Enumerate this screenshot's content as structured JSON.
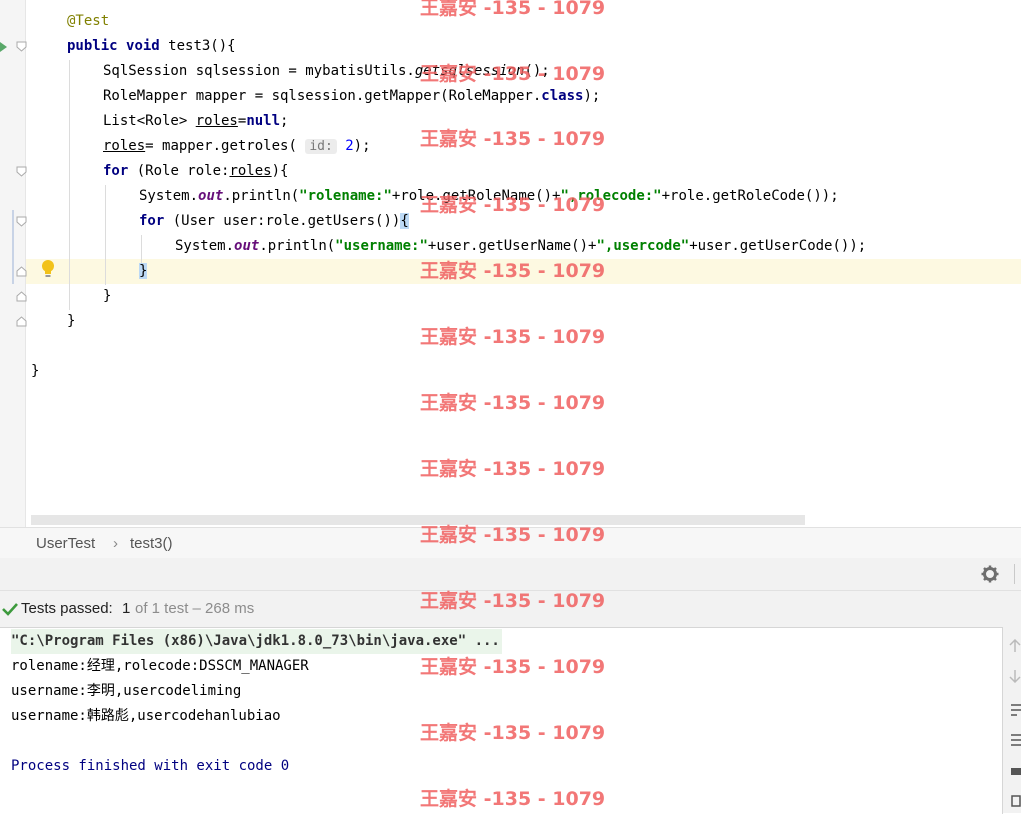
{
  "editor": {
    "lines": {
      "l1": "@Test",
      "l2_kw1": "public",
      "l2_kw2": "void",
      "l2_rest": " test3(){",
      "l3_a": "SqlSession sqlsession = mybatisUtils.",
      "l3_b": "getsqlsession",
      "l3_c": "();",
      "l4_a": "RoleMapper mapper = sqlsession.getMapper(RoleMapper.",
      "l4_kw": "class",
      "l4_c": ");",
      "l5_a": "List<Role> ",
      "l5_b": "roles",
      "l5_c": "=",
      "l5_kw": "null",
      "l5_d": ";",
      "l6_a": "roles",
      "l6_b": "= mapper.getroles( ",
      "l6_hint": "id:",
      "l6_num": "2",
      "l6_c": ");",
      "l7_kw": "for",
      "l7_a": " (Role role:",
      "l7_b": "roles",
      "l7_c": "){",
      "l8_a": "System.",
      "l8_fld": "out",
      "l8_b": ".println(",
      "l8_s1": "\"rolename:\"",
      "l8_c": "+role.getRoleName()+",
      "l8_s2": "\",rolecode:\"",
      "l8_d": "+role.getRoleCode());",
      "l9_kw": "for",
      "l9_a": " (User user:role.getUsers())",
      "l9_b": "{",
      "l10_a": "System.",
      "l10_fld": "out",
      "l10_b": ".println(",
      "l10_s1": "\"username:\"",
      "l10_c": "+user.getUserName()+",
      "l10_s2": "\",usercode\"",
      "l10_d": "+user.getUserCode());",
      "l11": "}",
      "l12": "}",
      "l13": "}",
      "l14": "}"
    }
  },
  "breadcrumb": {
    "class_name": "UserTest",
    "separator": "›",
    "method_name": "test3()"
  },
  "run": {
    "status_label": "Tests passed:",
    "passed_count": "1",
    "status_detail": "of 1 test – 268 ms",
    "console": [
      "\"C:\\Program Files (x86)\\Java\\jdk1.8.0_73\\bin\\java.exe\" ...",
      "rolename:经理,rolecode:DSSCM_MANAGER",
      "username:李明,usercodeliming",
      "username:韩路彪,usercodehanlubiao",
      "",
      "Process finished with exit code 0"
    ]
  },
  "watermark": "王嘉安 -135 - 1079",
  "colors": {
    "keyword": "#000080",
    "string": "#008000",
    "annotation": "#808000",
    "field": "#660e7a",
    "watermark": "#f06060",
    "pass_check": "#3d9a3d"
  },
  "icons": [
    "run-test-icon",
    "fold-icon",
    "bulb-icon",
    "settings-icon",
    "check-icon"
  ]
}
